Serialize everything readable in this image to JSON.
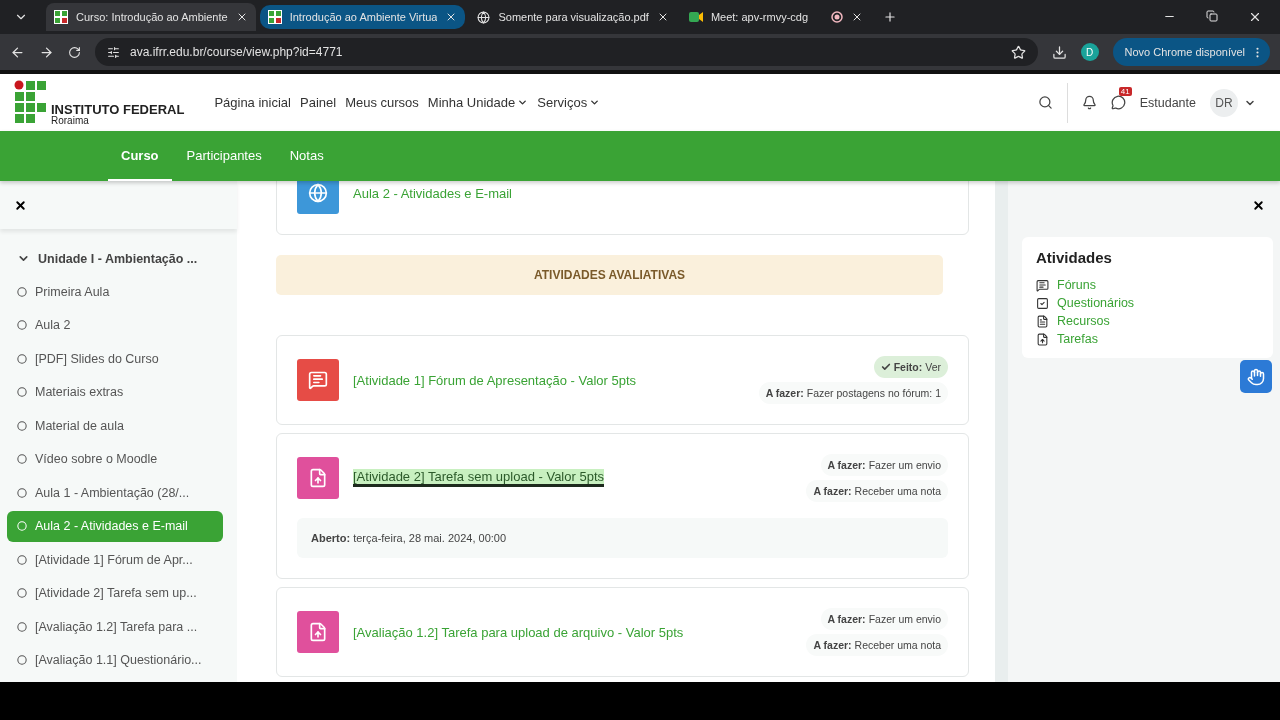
{
  "browser": {
    "tabs": [
      {
        "title": "Curso: Introdução ao Ambiente",
        "kind": "ifrr",
        "selected": false
      },
      {
        "title": "Introdução ao Ambiente Virtua",
        "kind": "ifrr",
        "selected": true
      },
      {
        "title": "Somente para visualização.pdf",
        "kind": "globe",
        "selected": false
      },
      {
        "title": "Meet: apv-rmvy-cdg",
        "kind": "meet",
        "selected": false
      }
    ],
    "url": "ava.ifrr.edu.br/course/view.php?id=4771",
    "profile": "D",
    "update_button": "Novo Chrome disponível"
  },
  "header": {
    "logo": {
      "title": "INSTITUTO FEDERAL",
      "subtitle": "Roraima"
    },
    "nav": [
      {
        "label": "Página inicial",
        "dropdown": false
      },
      {
        "label": "Painel",
        "dropdown": false
      },
      {
        "label": "Meus cursos",
        "dropdown": false
      },
      {
        "label": "Minha Unidade",
        "dropdown": true
      },
      {
        "label": "Serviços",
        "dropdown": true
      }
    ],
    "message_count": "41",
    "user_role": "Estudante",
    "avatar": "DR"
  },
  "course_nav": [
    {
      "label": "Curso",
      "selected": true
    },
    {
      "label": "Participantes",
      "selected": false
    },
    {
      "label": "Notas",
      "selected": false
    }
  ],
  "sidebar": {
    "section": {
      "label": "Unidade I - Ambientação ...",
      "expanded": true,
      "items": [
        {
          "label": "Primeira Aula",
          "selected": false
        },
        {
          "label": "Aula 2",
          "selected": false
        },
        {
          "label": "[PDF] Slides do Curso",
          "selected": false
        },
        {
          "label": "Materiais extras",
          "selected": false
        },
        {
          "label": "Material de aula",
          "selected": false
        },
        {
          "label": "Vídeo sobre o Moodle",
          "selected": false
        },
        {
          "label": "Aula 1 - Ambientação (28/...",
          "selected": false
        },
        {
          "label": "Aula 2 - Atividades e E-mail",
          "selected": true
        },
        {
          "label": "[Atividade 1] Fórum de Apr...",
          "selected": false
        },
        {
          "label": "[Atividade 2] Tarefa sem up...",
          "selected": false
        },
        {
          "label": "[Avaliação 1.2] Tarefa para ...",
          "selected": false
        },
        {
          "label": "[Avaliação 1.1] Questionário...",
          "selected": false
        }
      ]
    }
  },
  "content": [
    {
      "kind": "url",
      "title": "Aula 2 - Atividades e E-mail",
      "highlighted": false
    },
    {
      "kind": "heading",
      "title": "ATIVIDADES AVALIATIVAS"
    },
    {
      "kind": "forum",
      "title": "[Atividade 1] Fórum de Apresentação - Valor 5pts",
      "highlighted": false,
      "completion": [
        {
          "done": true,
          "label": "Feito:",
          "value": "Ver"
        },
        {
          "done": false,
          "label": "A fazer:",
          "value": "Fazer postagens no fórum: 1"
        }
      ]
    },
    {
      "kind": "assign",
      "title": "[Atividade 2] Tarefa sem upload - Valor 5pts",
      "highlighted": true,
      "completion": [
        {
          "done": false,
          "label": "A fazer:",
          "value": "Fazer um envio"
        },
        {
          "done": false,
          "label": "A fazer:",
          "value": "Receber uma nota"
        }
      ],
      "dates": [
        {
          "label": "Aberto:",
          "value": "terça-feira, 28 mai. 2024, 00:00"
        }
      ]
    },
    {
      "kind": "assign",
      "title": "[Avaliação 1.2] Tarefa para upload de arquivo - Valor 5pts",
      "highlighted": false,
      "completion": [
        {
          "done": false,
          "label": "A fazer:",
          "value": "Fazer um envio"
        },
        {
          "done": false,
          "label": "A fazer:",
          "value": "Receber uma nota"
        }
      ]
    }
  ],
  "right_drawer": {
    "title": "Atividades",
    "links": [
      {
        "label": "Fóruns",
        "kind": "forum"
      },
      {
        "label": "Questionários",
        "kind": "quiz"
      },
      {
        "label": "Recursos",
        "kind": "resource"
      },
      {
        "label": "Tarefas",
        "kind": "assign"
      }
    ]
  }
}
